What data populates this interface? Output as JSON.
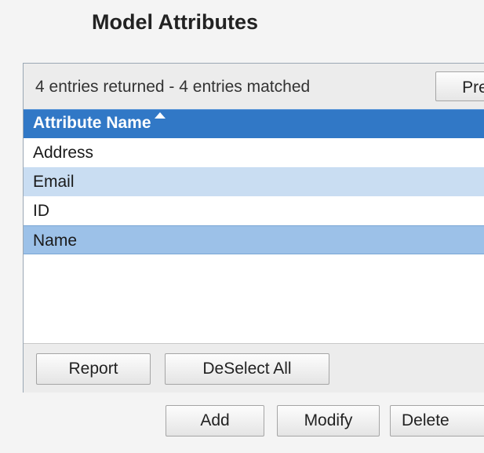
{
  "page": {
    "title": "Model Attributes"
  },
  "summary": {
    "text": "4 entries returned - 4 entries matched",
    "prev_label": "Pre"
  },
  "table": {
    "column_header": "Attribute Name",
    "rows": [
      {
        "name": "Address",
        "state": "normal"
      },
      {
        "name": "Email",
        "state": "alternate"
      },
      {
        "name": "ID",
        "state": "normal"
      },
      {
        "name": "Name",
        "state": "selected"
      }
    ]
  },
  "footer": {
    "report_label": "Report",
    "deselect_label": "DeSelect All"
  },
  "actions": {
    "add_label": "Add",
    "modify_label": "Modify",
    "delete_label": "Delete"
  },
  "colors": {
    "header": "#3178c6",
    "selected_row": "#9cc1e8",
    "alternate_row": "#c9ddf2"
  },
  "icons": {
    "sort": "sort-ascending-icon"
  }
}
